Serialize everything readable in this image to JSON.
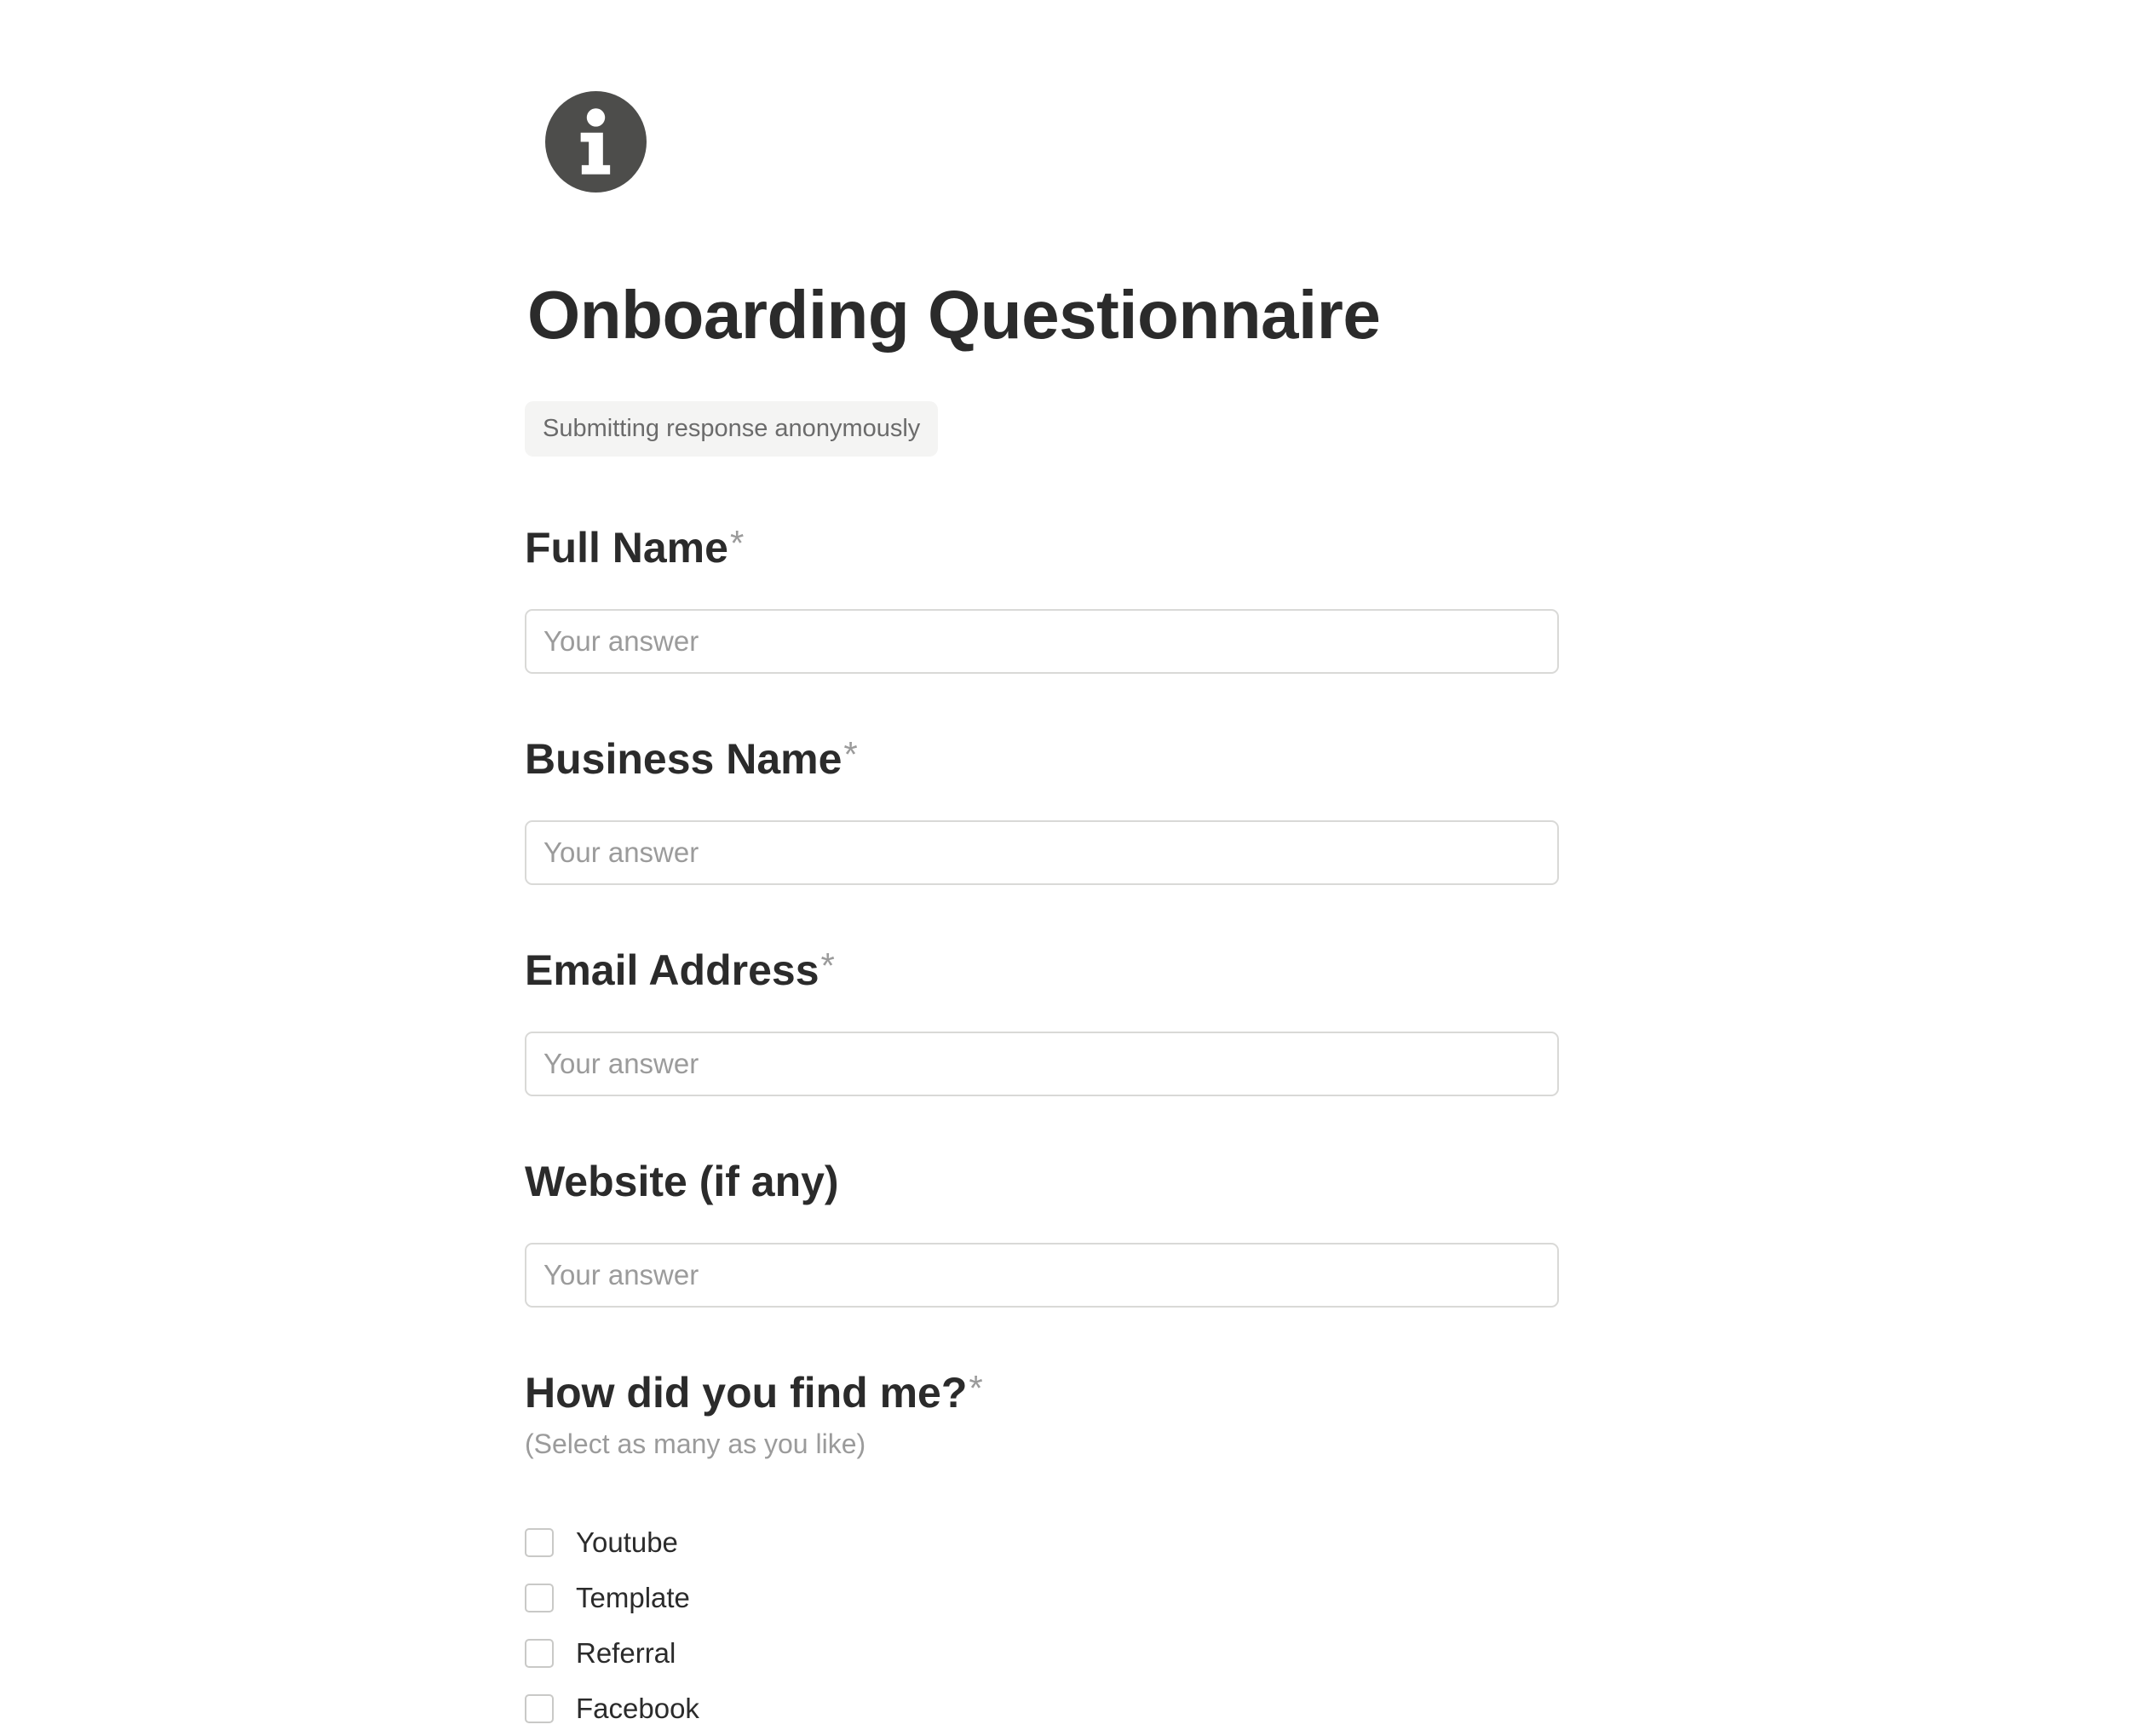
{
  "form": {
    "title": "Onboarding Questionnaire",
    "anonymous_notice": "Submitting response anonymously",
    "required_marker": "*",
    "questions": [
      {
        "label": "Full Name",
        "required": true,
        "placeholder": "Your answer",
        "value": ""
      },
      {
        "label": "Business Name",
        "required": true,
        "placeholder": "Your answer",
        "value": ""
      },
      {
        "label": "Email Address",
        "required": true,
        "placeholder": "Your answer",
        "value": ""
      },
      {
        "label": "Website (if any)",
        "required": false,
        "placeholder": "Your answer",
        "value": ""
      }
    ],
    "source_question": {
      "label": "How did you find me?",
      "required": true,
      "hint": "(Select as many as you like)",
      "options": [
        {
          "label": "Youtube",
          "checked": false
        },
        {
          "label": "Template",
          "checked": false
        },
        {
          "label": "Referral",
          "checked": false
        },
        {
          "label": "Facebook",
          "checked": false
        }
      ]
    }
  },
  "icons": {
    "header_icon": "info-circle-icon"
  },
  "colors": {
    "text": "#2b2b2b",
    "muted": "#9b9b9b",
    "icon_fill": "#4d4d4b",
    "input_border": "#d9d9d7",
    "badge_bg": "#f4f4f3"
  }
}
